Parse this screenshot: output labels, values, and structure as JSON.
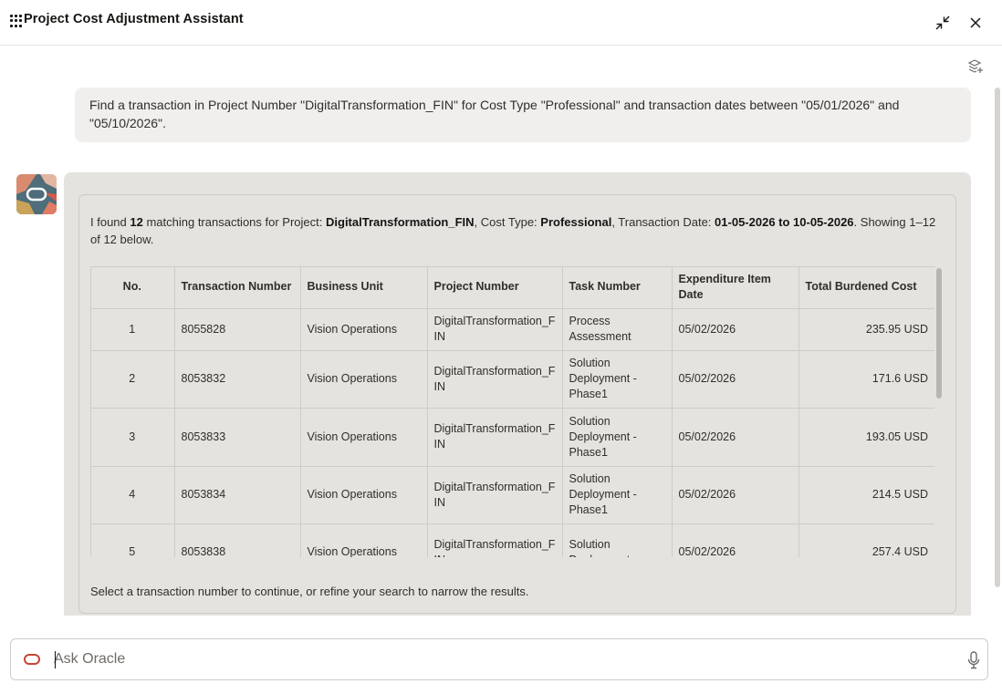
{
  "header": {
    "title": "Project Cost Adjustment Assistant",
    "icons": {
      "menu": "grid-dots-icon",
      "collapse": "collapse-arrows-icon",
      "close": "close-icon"
    }
  },
  "toolbar": {
    "layers_icon": "layers-add-icon"
  },
  "user_message": {
    "text": "Find a transaction in Project Number \"DigitalTransformation_FIN\" for Cost Type \"Professional\" and transaction dates between \"05/01/2026\" and \"05/10/2026\"."
  },
  "bot_message": {
    "intro": {
      "p1": "I found ",
      "count": "12",
      "p2": " matching transactions for Project: ",
      "project": "DigitalTransformation_FIN",
      "p3": ", Cost Type: ",
      "cost_type": "Professional",
      "p4": ", Transaction Date: ",
      "date_range": "01-05-2026 to 10-05-2026",
      "p5": ". Showing 1–12 of 12 below."
    },
    "table": {
      "columns": [
        "No.",
        "Transaction Number",
        "Business Unit",
        "Project Number",
        "Task Number",
        "Expenditure Item Date",
        "Total Burdened Cost"
      ],
      "rows": [
        {
          "no": "1",
          "txn": "8055828",
          "bu": "Vision Operations",
          "project": "DigitalTransformation_FIN",
          "task": "Process Assessment",
          "date": "05/02/2026",
          "cost": "235.95 USD"
        },
        {
          "no": "2",
          "txn": "8053832",
          "bu": "Vision Operations",
          "project": "DigitalTransformation_FIN",
          "task": "Solution Deployment - Phase1",
          "date": "05/02/2026",
          "cost": "171.6 USD"
        },
        {
          "no": "3",
          "txn": "8053833",
          "bu": "Vision Operations",
          "project": "DigitalTransformation_FIN",
          "task": "Solution Deployment - Phase1",
          "date": "05/02/2026",
          "cost": "193.05 USD"
        },
        {
          "no": "4",
          "txn": "8053834",
          "bu": "Vision Operations",
          "project": "DigitalTransformation_FIN",
          "task": "Solution Deployment - Phase1",
          "date": "05/02/2026",
          "cost": "214.5 USD"
        },
        {
          "no": "5",
          "txn": "8053838",
          "bu": "Vision Operations",
          "project": "DigitalTransformation_FIN",
          "task": "Solution Deployment -",
          "date": "05/02/2026",
          "cost": "257.4 USD"
        }
      ]
    },
    "footer": "Select a transaction number to continue, or refine your search to narrow the results."
  },
  "composer": {
    "placeholder": "Ask Oracle",
    "value": "",
    "icons": {
      "logo": "oracle-logo-icon",
      "mic": "microphone-icon"
    }
  },
  "colors": {
    "accent": "#c74634",
    "bubble": "#e5e3df",
    "user_bubble": "#f1efed"
  }
}
